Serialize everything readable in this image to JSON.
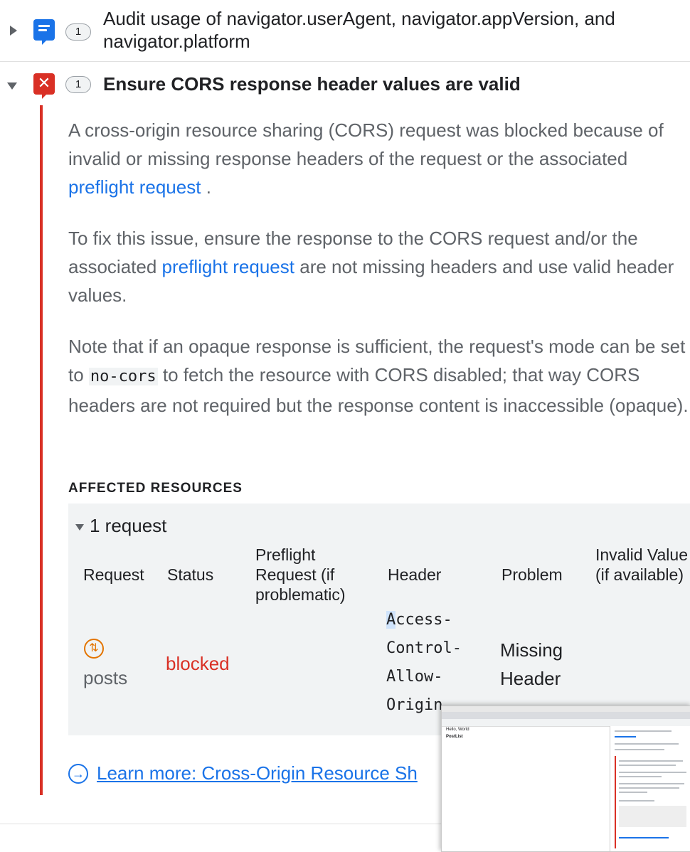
{
  "issues": [
    {
      "title": "Audit usage of navigator.userAgent, navigator.appVersion, and navigator.platform",
      "count": "1",
      "icon": "info-icon",
      "expanded": false
    },
    {
      "title": "Ensure CORS response header values are valid",
      "count": "1",
      "icon": "error-icon",
      "error_glyph": "✕",
      "expanded": true
    }
  ],
  "description": {
    "p1_text": "A cross-origin resource sharing (CORS) request was blocked because of invalid or missing response headers of the request or the associated",
    "p1_link": "preflight request",
    "p1_end": ".",
    "p2_text": "To fix this issue, ensure the response to the CORS request and/or the associated",
    "p2_link": "preflight request",
    "p2_end": "are not missing headers and use valid header values.",
    "p3_before": "Note that if an opaque response is sufficient, the request's mode can be set to",
    "p3_code": "no-cors",
    "p3_after": "to fetch the resource with CORS disabled; that way CORS headers are not required but the response content is inaccessible (opaque)."
  },
  "affected": {
    "heading": "AFFECTED RESOURCES",
    "toggle_label": "1 request",
    "columns": {
      "request": "Request",
      "status": "Status",
      "preflight": "Preflight Request (if problematic)",
      "header": "Header",
      "problem": "Problem",
      "invalid": "Invalid Value (if available)"
    },
    "row": {
      "request": "posts",
      "status": "blocked",
      "header_line1_hl": "A",
      "header_line1_rest": "ccess-",
      "header_line2": "Control-",
      "header_line3": "Allow-",
      "header_line4": "Origin",
      "problem": "Missing Header"
    }
  },
  "learn_more": "Learn more: Cross-Origin Resource Sh",
  "thumbnail": {
    "page_text_1": "Hello, World",
    "page_text_2": "PostList"
  },
  "colors": {
    "error": "#d93025",
    "link": "#1a73e8",
    "info": "#1a73e8",
    "network_icon": "#e37400"
  }
}
